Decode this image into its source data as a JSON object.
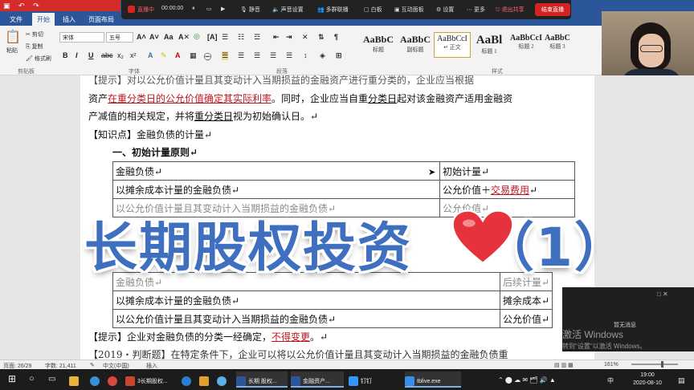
{
  "ribbon": {
    "tabs": [
      "文件",
      "开始",
      "插入",
      "页面布局"
    ],
    "paste": "粘贴",
    "clipboard_items": [
      "剪切",
      "复制",
      "格式刷"
    ],
    "clipboard_group": "剪贴板",
    "font_name": "宋体",
    "font_size": "五号",
    "font_group": "字体",
    "paragraph_group": "段落",
    "styles_group": "样式",
    "styles": [
      {
        "sample": "AaBbC",
        "name": "标题"
      },
      {
        "sample": "AaBbC",
        "name": "副标题"
      },
      {
        "sample": "AaBbCcI",
        "name": "↵ 正文"
      },
      {
        "sample": "AaBl",
        "name": "标题 1"
      },
      {
        "sample": "AaBbCcI",
        "name": "标题 2"
      },
      {
        "sample": "AaBbC",
        "name": "标题 3"
      }
    ],
    "font_buttons": [
      "B",
      "I",
      "U",
      "abc",
      "x₂",
      "x²",
      "A",
      "A"
    ]
  },
  "live_toolbar": {
    "status": "直播中",
    "timer": "00:00:00",
    "items": [
      "静音",
      "声音设置",
      "多群联播",
      "白板",
      "互动面板",
      "设置",
      "更多"
    ],
    "exit_share": "退出共享",
    "end_live": "结束直播"
  },
  "document": {
    "lines": {
      "top_cut": "【提示】对以公允价值计量且其变动计入当期损益的金融资产进行重分类的，企业应当根据",
      "l2_a": "资产",
      "l2_b": "在重分类日的公允价值确定其实际利率",
      "l2_c": "。同时，企业应当自重",
      "l2_d": "分类日",
      "l2_e": "起对该金融资产适用金融资",
      "l3_a": "产减值的相关规定，并将",
      "l3_b": "重分类日",
      "l3_c": "视为初始确认日。↵",
      "l4": "【知识点】金融负债的计量↵",
      "l5": "一、初始计量原则↵",
      "tip_a": "【提示】企业对金融负债的分类一经确定，",
      "tip_b": "不得变更",
      "tip_c": "。↵",
      "judge": "【2019・判断题】在特定条件下，企业可以将以公允价值计量且其变动计入当期损益的金融负债重"
    },
    "table1": [
      [
        "金融负债↵",
        "初始计量↵"
      ],
      [
        "以摊余成本计量的金融负债↵",
        "公允价值＋交易费用↵"
      ],
      [
        "以公允价值计量且其变动计入当期损益的金融负债↵",
        "公允价值↵"
      ]
    ],
    "table2": [
      [
        "金融负债↵",
        "后续计量↵"
      ],
      [
        "以摊余成本计量的金融负债↵",
        "摊余成本↵"
      ],
      [
        "以公允价值计量且其变动计入当期损益的金融负债↵",
        "公允价值↵"
      ]
    ],
    "red_term": "交易费用"
  },
  "banner": {
    "text": "长期股权投资",
    "suffix": "（1）"
  },
  "notification": {
    "text": "暂无消息",
    "activate_title": "激活 Windows",
    "activate_sub": "转到\"设置\"以激活 Windows。"
  },
  "status_bar": {
    "page": "页面: 26/29",
    "words": "字数: 21,411",
    "lang": "中文(中国)",
    "mode": "插入",
    "zoom": "161%"
  },
  "taskbar": {
    "apps": [
      "3长期股权...",
      "长期 股权...",
      "金融资产...",
      "钉钉",
      "tblive.exe"
    ],
    "time": "19:00",
    "date": "2020-08-10",
    "ime": "中"
  },
  "colors": {
    "word_blue": "#2b579a",
    "banner_blue": "#3f6fbf",
    "red_text": "#c0151f",
    "live_red": "#d42323"
  }
}
